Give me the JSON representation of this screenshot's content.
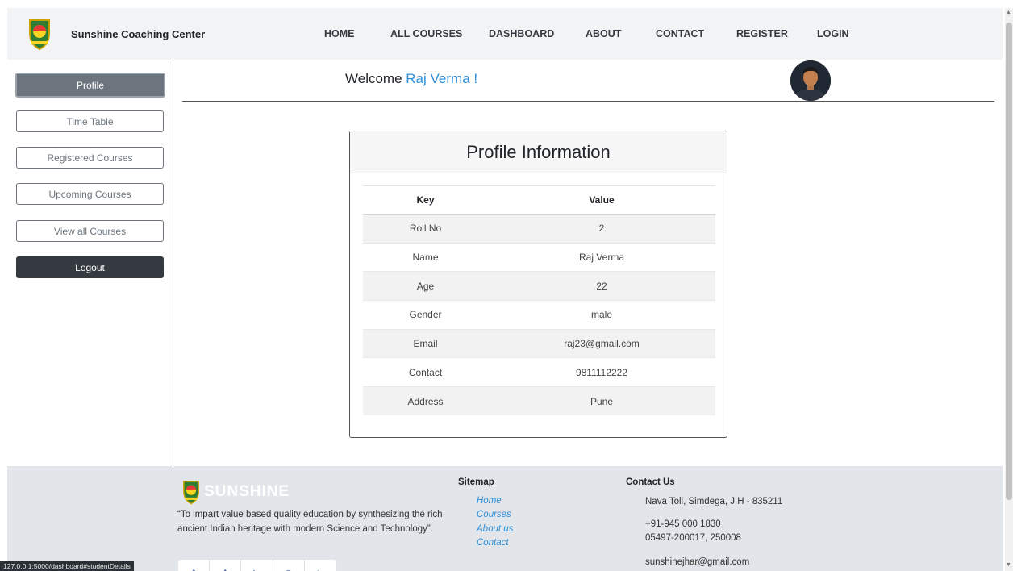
{
  "brand": {
    "name": "Sunshine Coaching Center"
  },
  "nav": [
    "HOME",
    "ALL COURSES",
    "DASHBOARD",
    "ABOUT",
    "CONTACT",
    "REGISTER",
    "LOGIN"
  ],
  "sidebar": {
    "items": [
      "Profile",
      "Time Table",
      "Registered Courses",
      "Upcoming Courses",
      "View all Courses"
    ],
    "logout": "Logout"
  },
  "welcome": {
    "prefix": "Welcome",
    "user": "Raj Verma !"
  },
  "profile": {
    "title": "Profile Information",
    "headers": [
      "Key",
      "Value"
    ],
    "rows": [
      [
        "Roll No",
        "2"
      ],
      [
        "Name",
        "Raj Verma"
      ],
      [
        "Age",
        "22"
      ],
      [
        "Gender",
        "male"
      ],
      [
        "Email",
        "raj23@gmail.com"
      ],
      [
        "Contact",
        "9811112222"
      ],
      [
        "Address",
        "Pune"
      ]
    ]
  },
  "footer": {
    "logo_text": "SUNSHINE",
    "quote": "“To impart value based quality education by synthesizing the rich ancient Indian heritage with modern Science and Technology”.",
    "sitemap": {
      "title": "Sitemap",
      "links": [
        "Home",
        "Courses",
        "About us",
        "Contact"
      ]
    },
    "contact": {
      "title": "Contact Us",
      "address": "Nava Toli, Simdega, J.H - 835211",
      "phone1": "+91-945 000 1830",
      "phone2": "05497-200017, 250008",
      "email": "sunshinejhar@gmail.com"
    }
  },
  "status_url": "127.0.0.1:5000/dashboard#studentDetails",
  "colors": {
    "accent": "#2f8fd8",
    "navbar_bg": "#f1f3f5",
    "footer_bg": "#e2e6ea",
    "sidebar_active": "#6c757d",
    "logout_bg": "#343a40"
  }
}
